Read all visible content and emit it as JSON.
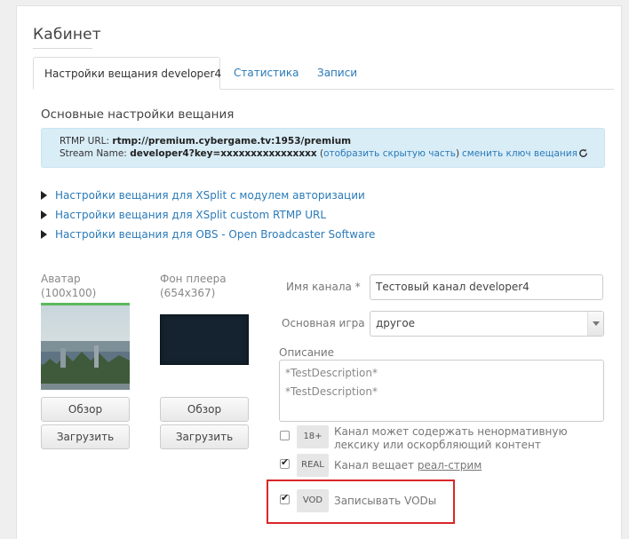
{
  "page": {
    "title": "Кабинет",
    "tabs": [
      {
        "label": "Настройки вещания developer4",
        "active": true
      },
      {
        "label": "Статистика",
        "active": false
      },
      {
        "label": "Записи",
        "active": false
      }
    ]
  },
  "broadcast": {
    "section_title": "Основные настройки вещания",
    "rtmp_label": "RTMP URL:",
    "rtmp_value": "rtmp://premium.cybergame.tv:1953/premium",
    "stream_label": "Stream Name:",
    "stream_value": "developer4?key=xxxxxxxxxxxxxxxx",
    "show_hidden_open": "(",
    "show_hidden_link": "отобразить скрытую часть",
    "show_hidden_close": ")",
    "change_key_link": "сменить ключ вещания",
    "links": [
      "Настройки вещания для XSplit с модулем авторизации",
      "Настройки вещания для XSplit custom RTMP URL",
      "Настройки вещания для OBS - Open Broadcaster Software"
    ]
  },
  "images": {
    "avatar_label": "Аватар",
    "avatar_size": "(100x100)",
    "bg_label": "Фон плеера",
    "bg_size": "(654x367)",
    "browse_label": "Обзор",
    "upload_label": "Загрузить"
  },
  "form": {
    "channel_name_label": "Имя канала *",
    "channel_name_value": "Тестовый канал developer4",
    "game_label": "Основная игра",
    "game_value": "другое",
    "description_label": "Описание",
    "description_value": "*TestDescription*\n*TestDescription*",
    "adult_badge": "18+",
    "adult_text": "Канал может содержать ненормативную лексику или оскорбляющий контент",
    "adult_checked": false,
    "real_badge": "REAL",
    "real_text_prefix": "Канал вещает ",
    "real_text_link": "реал-стрим",
    "real_checked": true,
    "vod_badge": "VOD",
    "vod_text": "Записывать VODы",
    "vod_checked": true
  },
  "colors": {
    "accent": "#2a7ab8",
    "info_bg": "#d9edf7",
    "highlight": "#d9262a"
  }
}
